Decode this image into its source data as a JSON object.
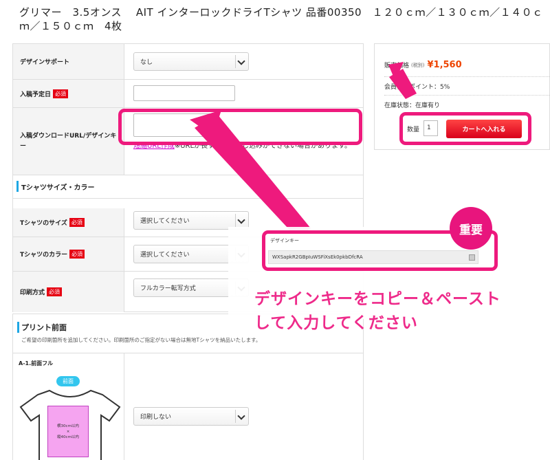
{
  "product": {
    "title": "グリマー　3.5オンス　 AIT インターロックドライTシャツ 品番00350　１２０ｃｍ／１３０ｃｍ／１４０ｃｍ／１５０ｃｍ　4枚"
  },
  "form": {
    "design_support": {
      "label": "デザインサポート",
      "value": "なし"
    },
    "submission_date": {
      "label": "入稿予定日",
      "required": "必須"
    },
    "download": {
      "label": "入稿ダウンロードURL/デザインキー",
      "link": "短縮URL作成",
      "note": "※URLが長すぎると申し込みができない場合があります。"
    },
    "section_size_color": "Tシャツサイズ・カラー",
    "size": {
      "label": "Tシャツのサイズ",
      "required": "必須",
      "value": "選択してください"
    },
    "color": {
      "label": "Tシャツのカラー",
      "required": "必須",
      "value": "選択してください"
    },
    "method": {
      "label": "印刷方式",
      "required": "必須",
      "value": "フルカラー転写方式"
    }
  },
  "print": {
    "title": "プリント前面",
    "description": "ご希望の印刷箇所を追加してください。印刷箇所のご指定がない場合は無地Tシャツを納品いたします。",
    "position_label": "A-1.前面フル",
    "badge": "前面",
    "area_line1": "横30cm以内",
    "area_line2": "×",
    "area_line3": "縦40cm以内",
    "value": "印刷しない"
  },
  "cart": {
    "price_label": "販売価格",
    "tax_label": "(税別)",
    "price": "¥1,560",
    "points": "会員付与ポイント：5%",
    "stock": "在庫状態：在庫有り",
    "qty_label": "数量",
    "qty_value": "1",
    "button": "カートへ入れる"
  },
  "overlay": {
    "important": "重要",
    "design_key_label": "デザインキー",
    "design_key_value": "WXSapkR2GBpIuWSFiXsEk0pkbDfcRA",
    "guide_line1": "デザインキーをコピー＆ペースト",
    "guide_line2": "して入力してください"
  },
  "colors": {
    "accent_pink": "#ee1a7d",
    "cart_red": "#e60012",
    "price_orange": "#ee4400",
    "section_blue": "#1ea7e4"
  }
}
